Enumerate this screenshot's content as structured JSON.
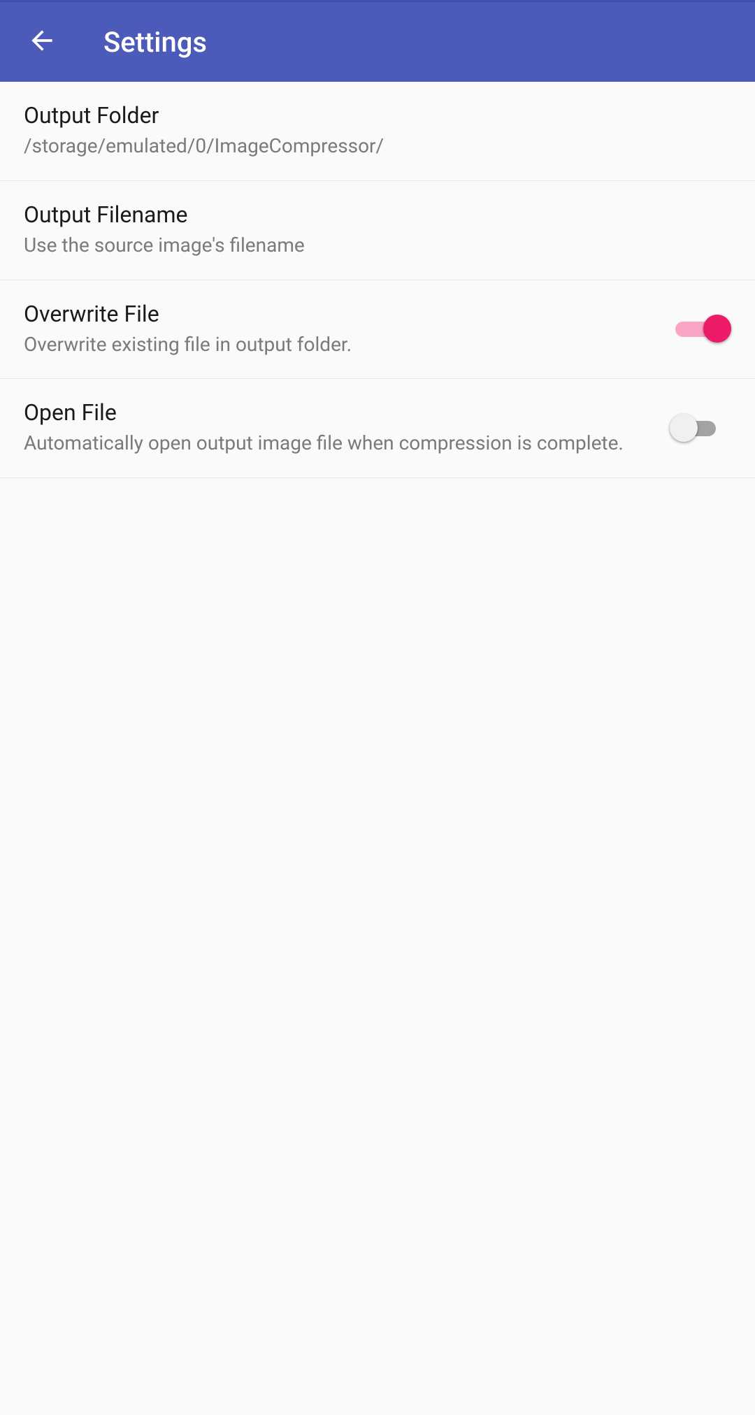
{
  "header": {
    "title": "Settings"
  },
  "settings": {
    "output_folder": {
      "title": "Output Folder",
      "subtitle": "/storage/emulated/0/ImageCompressor/"
    },
    "output_filename": {
      "title": "Output Filename",
      "subtitle": "Use the source image's filename"
    },
    "overwrite_file": {
      "title": "Overwrite File",
      "subtitle": "Overwrite existing file in output folder.",
      "enabled": true
    },
    "open_file": {
      "title": "Open File",
      "subtitle": "Automatically open output image file when compression is complete.",
      "enabled": false
    }
  }
}
